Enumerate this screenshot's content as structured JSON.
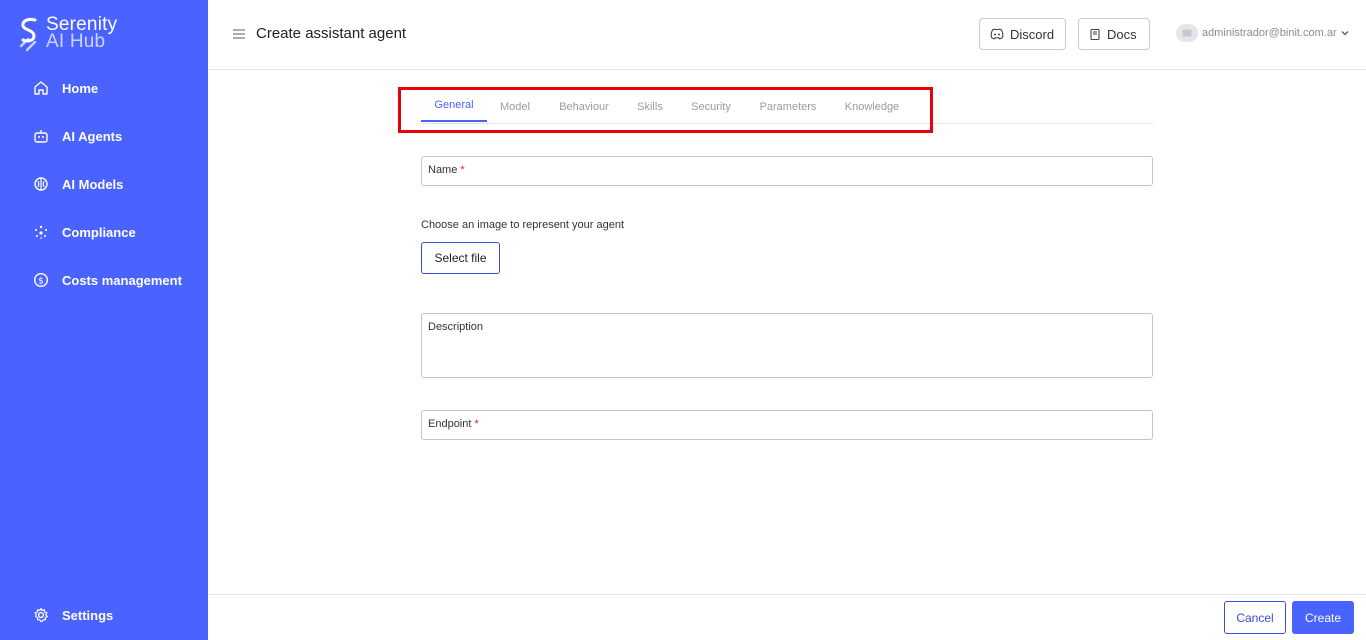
{
  "brand": {
    "line1": "Serenity",
    "line2": "AI Hub",
    "logo_icon": "serenity-logo-icon"
  },
  "sidebar": {
    "items": [
      {
        "label": "Home",
        "icon": "home-icon"
      },
      {
        "label": "AI Agents",
        "icon": "robot-icon"
      },
      {
        "label": "AI Models",
        "icon": "brain-icon"
      },
      {
        "label": "Compliance",
        "icon": "sparkle-dots-icon"
      },
      {
        "label": "Costs management",
        "icon": "dollar-circle-icon"
      }
    ],
    "settings": {
      "label": "Settings",
      "icon": "gear-icon"
    }
  },
  "header": {
    "title": "Create assistant agent",
    "menu_icon": "hamburger-menu-icon",
    "discord_label": "Discord",
    "docs_label": "Docs",
    "user_email": "administrador@binit.com.ar"
  },
  "tabs": [
    {
      "label": "General",
      "active": true
    },
    {
      "label": "Model",
      "active": false
    },
    {
      "label": "Behaviour",
      "active": false
    },
    {
      "label": "Skills",
      "active": false
    },
    {
      "label": "Security",
      "active": false
    },
    {
      "label": "Parameters",
      "active": false
    },
    {
      "label": "Knowledge",
      "active": false
    }
  ],
  "form": {
    "name_label": "Name",
    "required_mark": "*",
    "image_prompt": "Choose an image to represent your agent",
    "select_file_label": "Select file",
    "description_label": "Description",
    "endpoint_label": "Endpoint",
    "name_value": "",
    "description_value": "",
    "endpoint_value": ""
  },
  "footer": {
    "cancel_label": "Cancel",
    "create_label": "Create"
  },
  "colors": {
    "primary": "#4a63ff",
    "highlight": "#e8000b",
    "required": "#e11d2b"
  }
}
